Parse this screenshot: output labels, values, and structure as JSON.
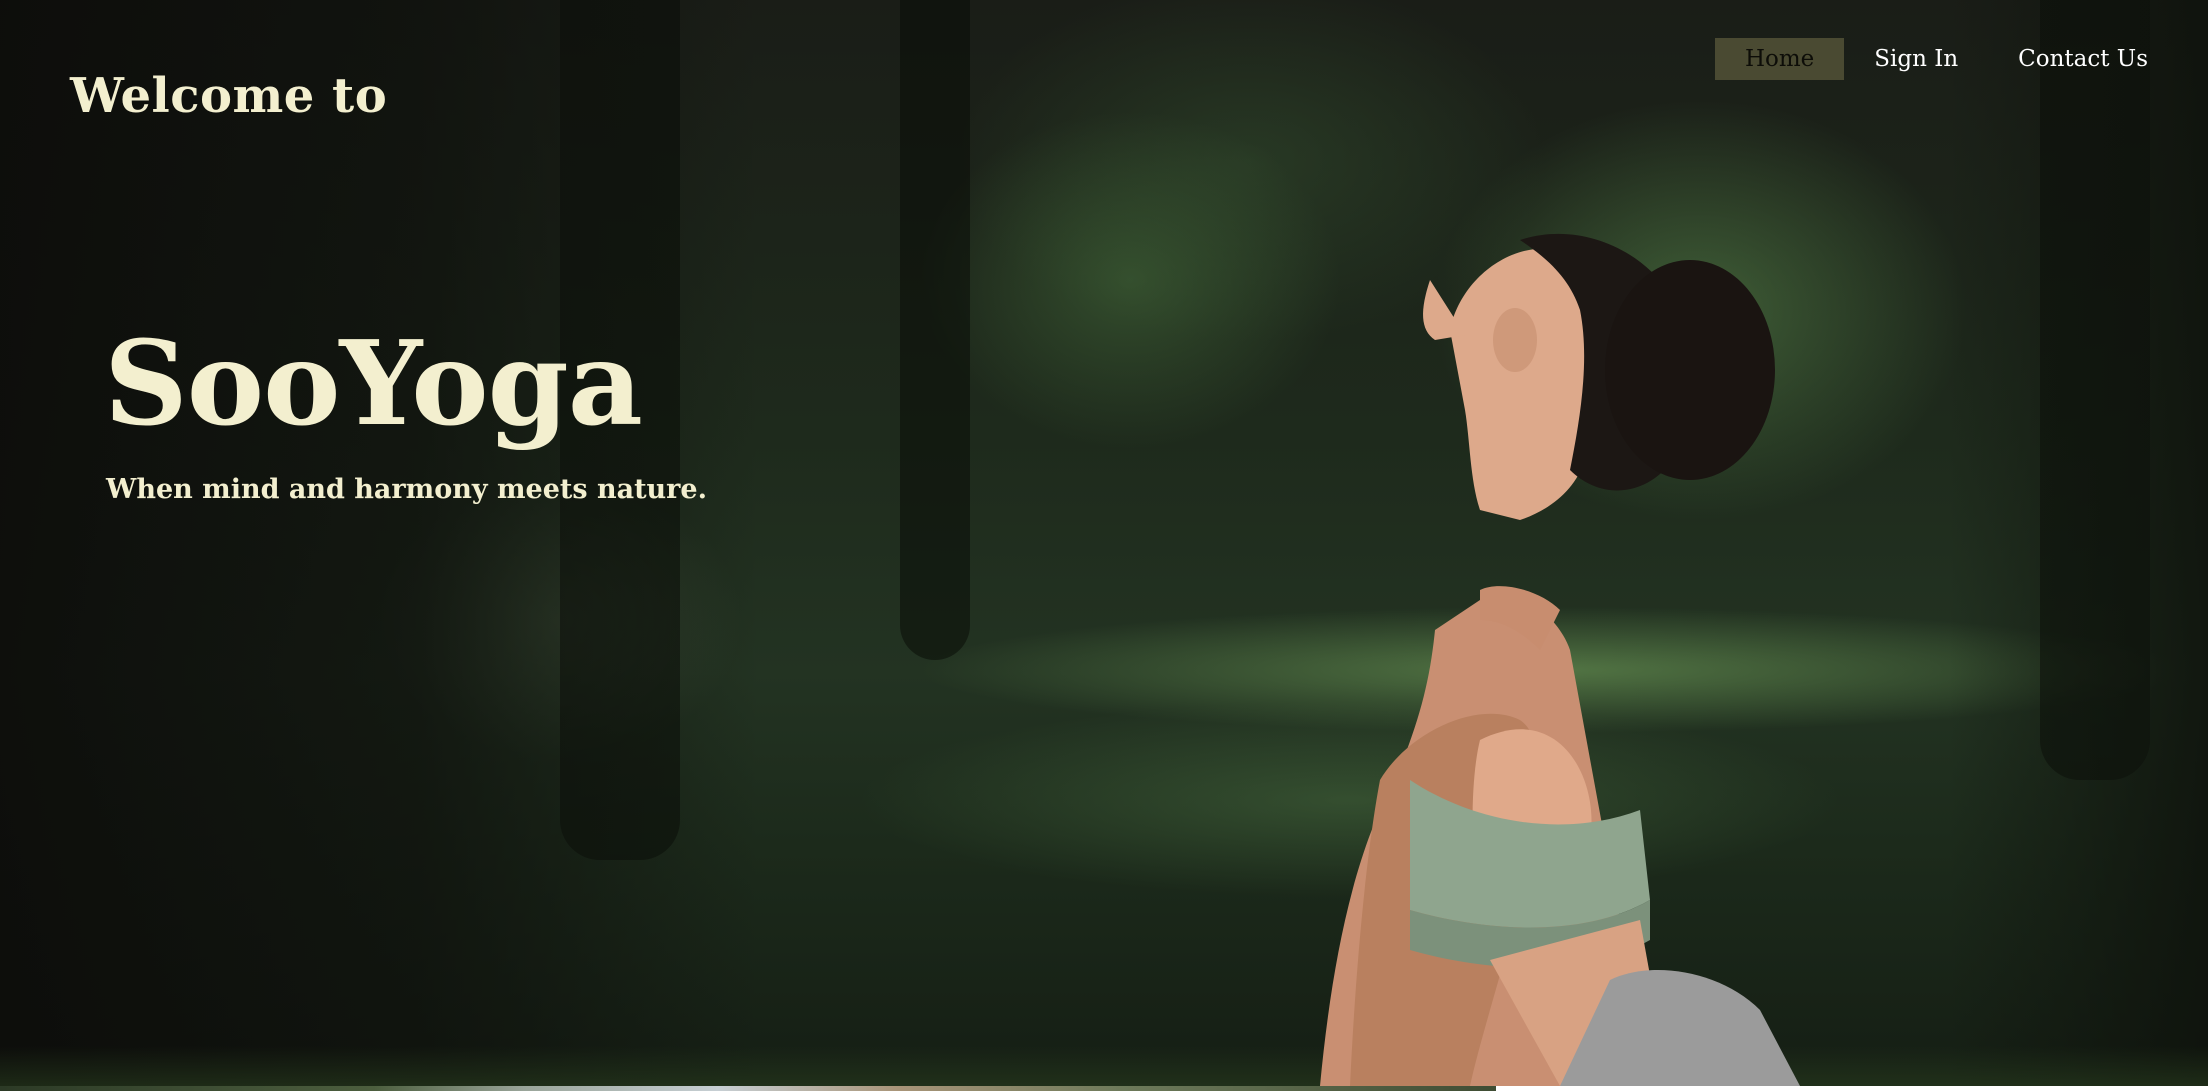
{
  "header": {
    "welcome": "Welcome to"
  },
  "nav": {
    "items": [
      {
        "label": "Home",
        "active": true
      },
      {
        "label": "Sign In",
        "active": false
      },
      {
        "label": "Contact Us",
        "active": false
      }
    ]
  },
  "hero": {
    "title": "SooYoga",
    "tagline": "When mind and harmony meets nature.",
    "image_subject": "woman-in-yoga-pose-outdoors"
  },
  "colors": {
    "title_text": "#f3efcf",
    "nav_active_bg": "#4a4a32",
    "nav_text": "#ffffff"
  }
}
